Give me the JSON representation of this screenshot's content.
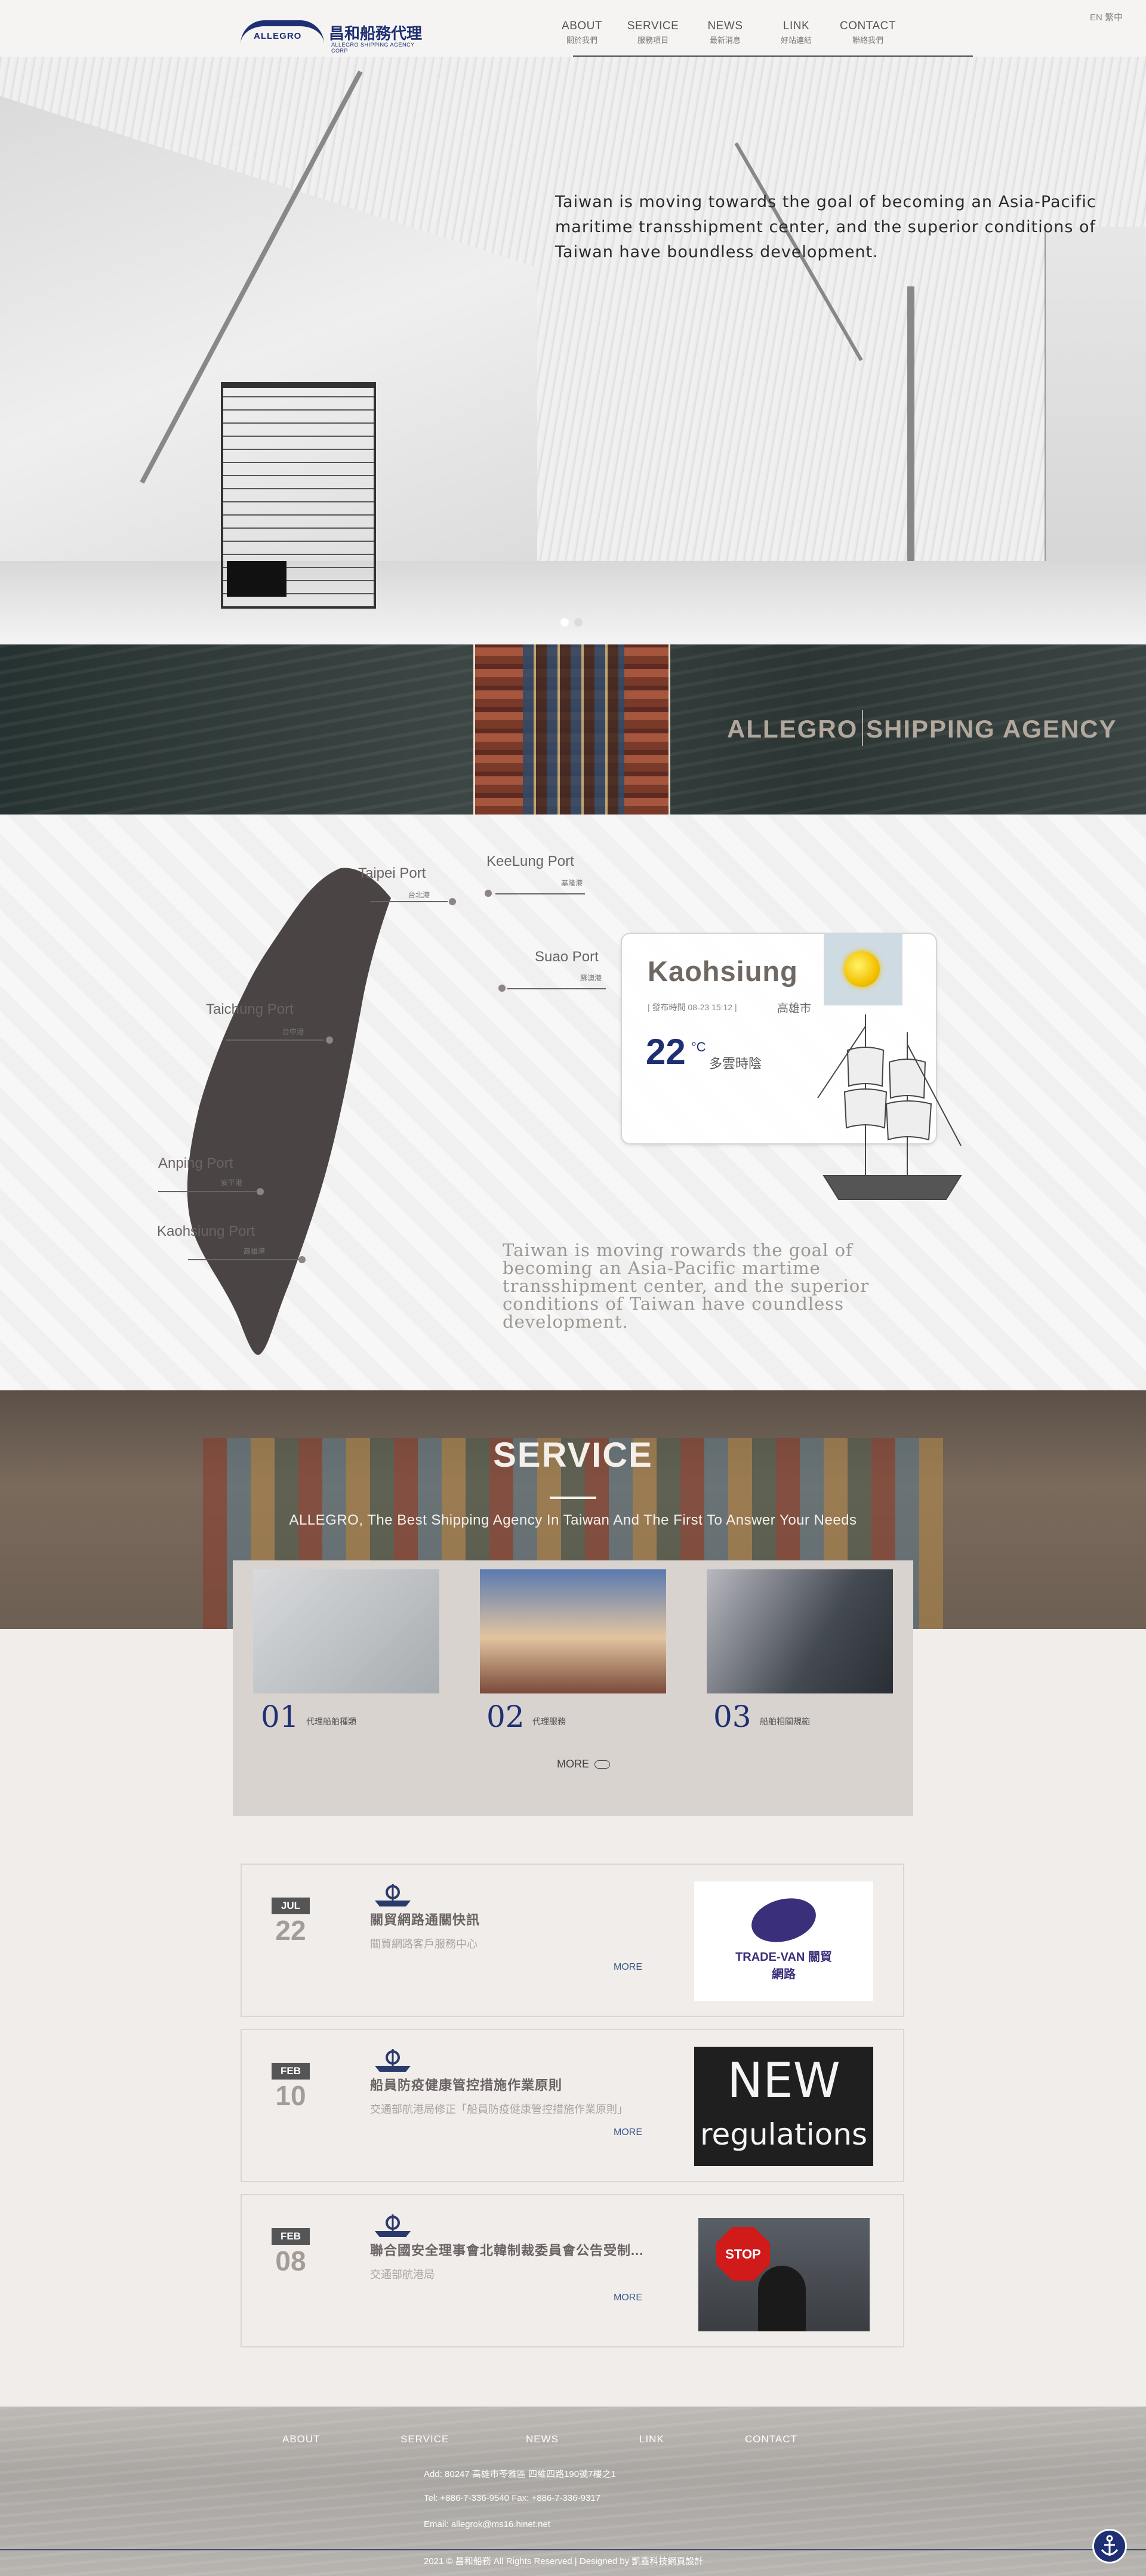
{
  "header": {
    "logo_brand": "ALLEGRO",
    "logo_cn": "昌和船務代理",
    "logo_en": "ALLEGRO SHIPPING AGENCY CORP",
    "lang": "EN  繁中",
    "nav": [
      {
        "en": "ABOUT",
        "cn": "關於我們"
      },
      {
        "en": "SERVICE",
        "cn": "服務項目"
      },
      {
        "en": "NEWS",
        "cn": "最新消息"
      },
      {
        "en": "LINK",
        "cn": "好站連結"
      },
      {
        "en": "CONTACT",
        "cn": "聯絡我們"
      }
    ]
  },
  "hero": {
    "text": "Taiwan is moving towards the goal of becoming an Asia-Pacific maritime transshipment center, and the superior conditions of Taiwan have boundless development."
  },
  "banner": {
    "title": "ALLEGRO SHIPPING AGENCY"
  },
  "map": {
    "ports": [
      {
        "name": "Taipei Port",
        "cn": "台北港"
      },
      {
        "name": "KeeLung Port",
        "cn": "基隆港"
      },
      {
        "name": "Suao Port",
        "cn": "蘇澳港"
      },
      {
        "name": "Taichung Port",
        "cn": "台中港"
      },
      {
        "name": "Anping Port",
        "cn": "安平港"
      },
      {
        "name": "Kaohsiung Port",
        "cn": "高雄港"
      }
    ],
    "text": "Taiwan is moving rowards the goal of becoming an Asia-Pacific martime transshipment center, and the superior conditions of Taiwan have coundless development."
  },
  "weather": {
    "city": "Kaohsiung",
    "meta": "| 發布時間 08-23 15:12 |",
    "location": "高雄市",
    "temp": "22",
    "unit": "°C",
    "desc": "多雲時陰",
    "icon": "sun-icon"
  },
  "service": {
    "title": "SERVICE",
    "subtitle": "ALLEGRO, The Best Shipping Agency In Taiwan And The First To Answer Your Needs",
    "items": [
      {
        "num": "01",
        "label": "代理船舶種類"
      },
      {
        "num": "02",
        "label": "代理服務"
      },
      {
        "num": "03",
        "label": "船舶相關規範"
      }
    ],
    "more": "MORE"
  },
  "news": [
    {
      "month": "JUL",
      "day": "22",
      "title": "關貿網路通關快訊",
      "desc": "關貿網路客戶服務中心",
      "more": "MORE",
      "image_text": "TRADE-VAN 關貿網路"
    },
    {
      "month": "FEB",
      "day": "10",
      "title": "船員防疫健康管控措施作業原則",
      "desc": "交通部航港局修正「船員防疫健康管控措施作業原則」",
      "more": "MORE",
      "image_text_1": "NEW",
      "image_text_2": "regulations"
    },
    {
      "month": "FEB",
      "day": "08",
      "title": "聯合國安全理事會北韓制裁委員會公告受制...",
      "desc": "交通部航港局",
      "more": "MORE",
      "image_text": "STOP"
    }
  ],
  "footer": {
    "nav": [
      "ABOUT",
      "SERVICE",
      "NEWS",
      "LINK",
      "CONTACT"
    ],
    "add": "Add: 80247 高雄市苓雅區 四維四路190號7樓之1",
    "tel": "Tel: +886-7-336-9540   Fax: +886-7-336-9317",
    "email": "Email: allegrok@ms16.hinet.net",
    "copyright": "2021 © 昌和船務 All Rights Reserved | Designed by 凱鑫科技網頁設計"
  },
  "colors": {
    "navy": "#1e2f73",
    "text": "#4a4444",
    "bg": "#f1edeb"
  }
}
